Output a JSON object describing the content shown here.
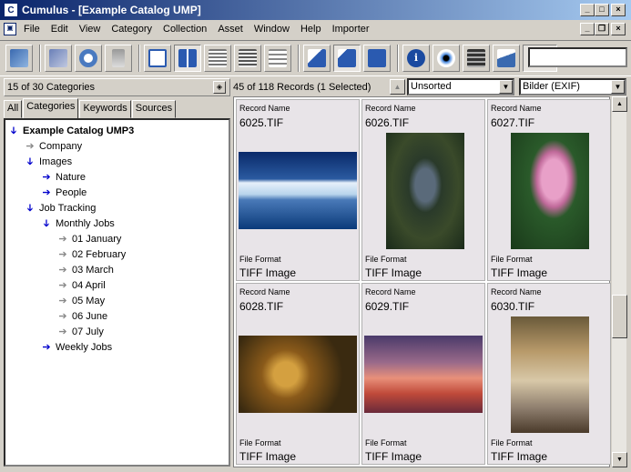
{
  "window": {
    "title": "Cumulus - [Example Catalog UMP]",
    "controls": [
      "_",
      "□",
      "×"
    ],
    "doc_controls": [
      "_",
      "❐",
      "×"
    ]
  },
  "menu": [
    "File",
    "Edit",
    "View",
    "Category",
    "Collection",
    "Asset",
    "Window",
    "Help",
    "Importer"
  ],
  "toolbar": {
    "buttons": [
      "sync-icon",
      "catalog-icon",
      "lifebuoy-icon",
      "trash-icon",
      "view-list-icon",
      "view-thumbnail-icon",
      "view-details-icon",
      "view-columns-icon",
      "view-table-icon",
      "small-preview-icon",
      "medium-preview-icon",
      "large-preview-icon",
      "info-icon",
      "eye-icon",
      "film-icon",
      "filter-icon",
      "find-icon"
    ],
    "search_value": ""
  },
  "left_panel": {
    "header": "15 of 30 Categories",
    "tabs": [
      "All",
      "Categories",
      "Keywords",
      "Sources"
    ],
    "active_tab": "Categories",
    "tree": [
      {
        "label": "Example Catalog UMP3",
        "arrow": "down",
        "bold": true
      },
      {
        "label": "Company",
        "arrow": "right"
      },
      {
        "label": "Images",
        "arrow": "down"
      },
      {
        "label": "Nature",
        "arrow": "rightblue"
      },
      {
        "label": "People",
        "arrow": "rightblue"
      },
      {
        "label": "Job Tracking",
        "arrow": "down"
      },
      {
        "label": "Monthly Jobs",
        "arrow": "down"
      },
      {
        "label": "01 January",
        "arrow": "right"
      },
      {
        "label": "02 February",
        "arrow": "right"
      },
      {
        "label": "03 March",
        "arrow": "right"
      },
      {
        "label": "04 April",
        "arrow": "right"
      },
      {
        "label": "05 May",
        "arrow": "right"
      },
      {
        "label": "06 June",
        "arrow": "right"
      },
      {
        "label": "07 July",
        "arrow": "right"
      },
      {
        "label": "Weekly Jobs",
        "arrow": "rightblue"
      }
    ]
  },
  "right_panel": {
    "header": "45 of 118 Records (1 Selected)",
    "sort_value": "Unsorted",
    "view_set_value": "Bilder (EXIF)",
    "field_labels": {
      "record_name": "Record Name",
      "file_format": "File Format"
    },
    "records": [
      {
        "name": "6025.TIF",
        "format": "TIFF Image",
        "image": "iceberg-photo"
      },
      {
        "name": "6026.TIF",
        "format": "TIFF Image",
        "image": "heron-photo"
      },
      {
        "name": "6027.TIF",
        "format": "TIFF Image",
        "image": "pink-flower-photo"
      },
      {
        "name": "6028.TIF",
        "format": "TIFF Image",
        "image": "jaguar-photo"
      },
      {
        "name": "6029.TIF",
        "format": "TIFF Image",
        "image": "sunset-photo"
      },
      {
        "name": "6030.TIF",
        "format": "TIFF Image",
        "image": "horses-in-mist-photo"
      }
    ]
  }
}
